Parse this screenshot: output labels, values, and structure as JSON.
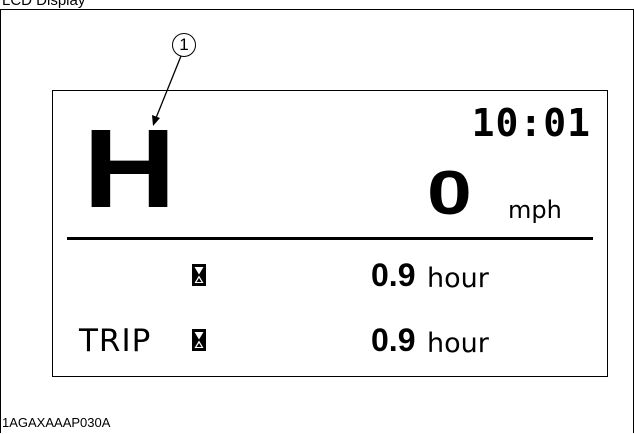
{
  "figure": {
    "header_text": "LCD Display",
    "callout_number": "1",
    "figure_id": "1AGAXAAAP030A"
  },
  "display": {
    "gear": "H",
    "clock": "10:01",
    "speed": {
      "value": "0",
      "unit": "mph"
    },
    "hour_meter": {
      "icon": "hourglass-icon",
      "value": "0.9",
      "unit": "hour"
    },
    "trip_meter": {
      "label": "TRIP",
      "icon": "hourglass-icon",
      "value": "0.9",
      "unit": "hour"
    }
  }
}
